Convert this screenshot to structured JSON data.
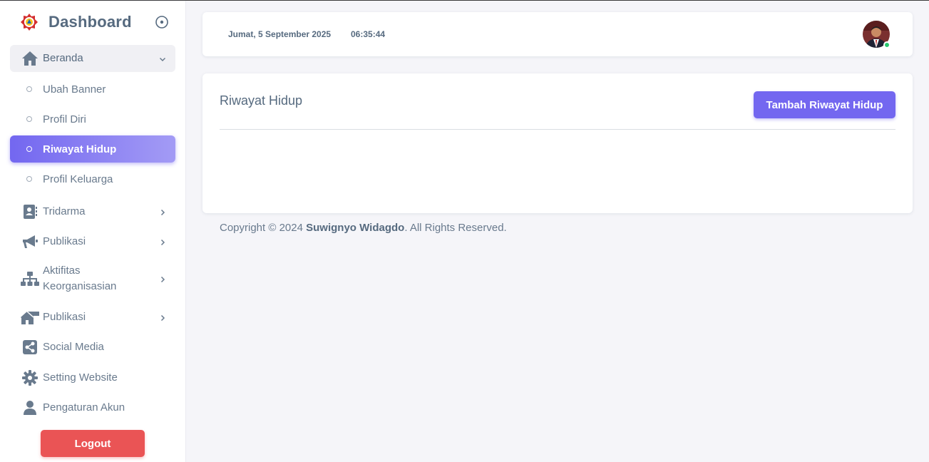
{
  "brand": {
    "title": "Dashboard",
    "logo_icon": "emblem-logo-icon",
    "toggle_icon": "circle-dot-icon"
  },
  "sidebar": {
    "menu": [
      {
        "label": "Beranda",
        "icon": "home-icon",
        "expanded": true
      },
      {
        "label": "Tridarma",
        "icon": "contact-card-icon"
      },
      {
        "label": "Publikasi",
        "icon": "megaphone-icon"
      },
      {
        "label": "Aktifitas Keorganisasian",
        "icon": "org-chart-icon"
      },
      {
        "label": "Publikasi",
        "icon": "house-icon"
      },
      {
        "label": "Social Media",
        "icon": "share-icon"
      },
      {
        "label": "Setting Website",
        "icon": "gear-icon"
      },
      {
        "label": "Pengaturan Akun",
        "icon": "user-icon"
      }
    ],
    "submenu": [
      {
        "label": "Ubah Banner"
      },
      {
        "label": "Profil Diri"
      },
      {
        "label": "Riwayat Hidup",
        "active": true
      },
      {
        "label": "Profil Keluarga"
      }
    ],
    "aktifitas_line1": "Aktifitas",
    "aktifitas_line2": "Keorganisasian",
    "logout_label": "Logout"
  },
  "navbar": {
    "date": "Jumat, 5 September 2025",
    "time": "06:35:44",
    "status_color": "#28c76f"
  },
  "main": {
    "card_title": "Riwayat Hidup",
    "add_button_label": "Tambah Riwayat Hidup"
  },
  "footer": {
    "prefix": "Copyright © 2024 ",
    "owner": "Suwignyo Widagdo",
    "suffix": ". All Rights Reserved."
  },
  "colors": {
    "accent": "#7367f0",
    "danger": "#ea5455",
    "background": "#f5f5f9"
  }
}
